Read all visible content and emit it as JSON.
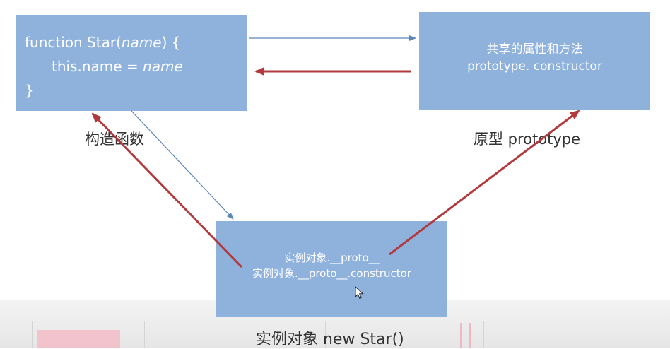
{
  "constructor_box": {
    "line1_prefix": "function Star(",
    "line1_param": "name",
    "line1_suffix": ") {",
    "line2_prefix": "this.name = ",
    "line2_value": "name",
    "line3": "}"
  },
  "prototype_box": {
    "line1": "共享的属性和方法",
    "line2": "prototype. constructor"
  },
  "instance_box": {
    "line1": "实例对象.__proto__",
    "line2": "实例对象.__proto__.constructor"
  },
  "captions": {
    "constructor": "构造函数",
    "prototype": "原型 prototype",
    "instance": "实例对象 new Star()"
  },
  "colors": {
    "box": "#8fb2dc",
    "thin_arrow": "#5b86b8",
    "thick_arrow": "#b23a3f"
  },
  "icons": {
    "cursor": "mouse-pointer-icon"
  }
}
